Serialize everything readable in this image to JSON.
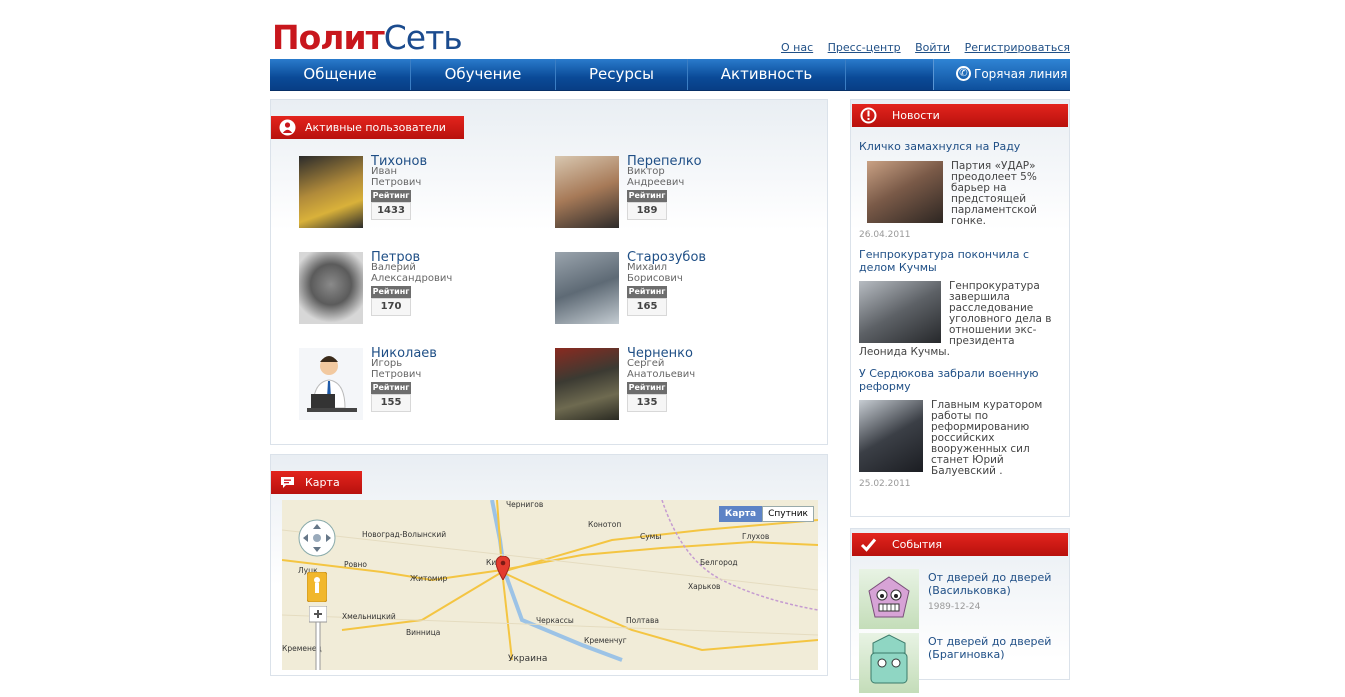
{
  "logo": {
    "part1": "Полит",
    "part2": "Сеть"
  },
  "top_links": [
    "О нас",
    "Пресс-центр",
    "Войти",
    "Регистрироваться"
  ],
  "nav": [
    "Общение",
    "Обучение",
    "Ресурсы",
    "Активность"
  ],
  "hotline": "Горячая линия",
  "active_users": {
    "title": "Активные пользователи",
    "rating_label": "Рейтинг",
    "users": [
      {
        "last": "Тихонов",
        "first": "Иван",
        "middle": "Петрович",
        "rating": "1433"
      },
      {
        "last": "Перепелко",
        "first": "Виктор",
        "middle": "Андреевич",
        "rating": "189"
      },
      {
        "last": "Петров",
        "first": "Валерий",
        "middle": "Александрович",
        "rating": "170"
      },
      {
        "last": "Старозубов",
        "first": "Михаил",
        "middle": "Борисович",
        "rating": "165"
      },
      {
        "last": "Николаев",
        "first": "Игорь",
        "middle": "Петрович",
        "rating": "155"
      },
      {
        "last": "Черненко",
        "first": "Сергей",
        "middle": "Анатольевич",
        "rating": "135"
      }
    ]
  },
  "map": {
    "title": "Карта",
    "mode_map": "Карта",
    "mode_sat": "Спутник",
    "cities": [
      "Чернигов",
      "Луцк",
      "Ровно",
      "Житомир",
      "Киев",
      "Сумы",
      "Глухов",
      "Белгород",
      "Харьков",
      "Хмельницкий",
      "Винница",
      "Черкассы",
      "Кременчуг",
      "Полтава",
      "Украина",
      "Конотоп",
      "Новоград-Волынский",
      "Кременец"
    ]
  },
  "news": {
    "title": "Новости",
    "items": [
      {
        "title": "Кличко замахнулся на Раду",
        "text": "Партия «УДАР» преодолеет 5% барьер на предстоящей парламентской гонке.",
        "date": "26.04.2011"
      },
      {
        "title": "Генпрокуратура покончила с делом Кучмы",
        "text": "Генпрокуратура завершила расследование уголовного дела в отношении экс-президента Леонида Кучмы.",
        "date": ""
      },
      {
        "title": "У Сердюкова забрали военную реформу",
        "text": "Главным куратором работы по реформированию российских вооруженных сил станет Юрий Балуевский .",
        "date": "25.02.2011"
      }
    ]
  },
  "events": {
    "title": "События",
    "items": [
      {
        "title": "От дверей до дверей (Васильковка)",
        "date": "1989-12-24"
      },
      {
        "title": "От дверей до дверей (Брагиновка)",
        "date": ""
      }
    ]
  },
  "colors": {
    "brand_red": "#c8171d",
    "brand_blue": "#0a4a97",
    "link": "#1f4f86"
  }
}
